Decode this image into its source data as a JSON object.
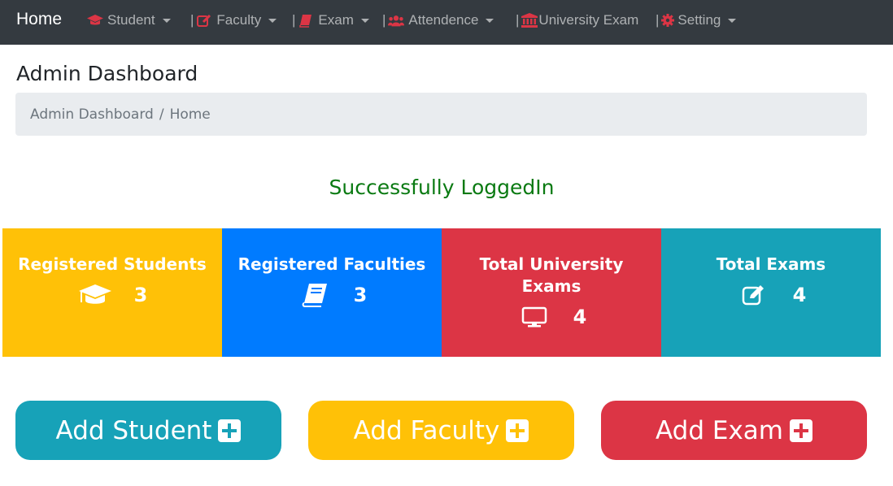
{
  "navbar": {
    "brand": "Home",
    "items": [
      {
        "label": "Student",
        "icon": "graduation-cap-icon",
        "separator": "",
        "dropdown": true
      },
      {
        "label": "Faculty",
        "icon": "edit-icon",
        "separator": "|",
        "dropdown": true
      },
      {
        "label": "Exam",
        "icon": "book-icon",
        "separator": "|",
        "dropdown": true
      },
      {
        "label": "Attendence",
        "icon": "users-icon",
        "separator": "|",
        "dropdown": true
      },
      {
        "label": "University Exam",
        "icon": "university-icon",
        "separator": "|",
        "dropdown": false
      },
      {
        "label": "Setting",
        "icon": "gear-icon",
        "separator": "|",
        "dropdown": true
      }
    ],
    "icon_color": "#dc3545"
  },
  "page": {
    "title": "Admin Dashboard",
    "breadcrumb": [
      "Admin Dashboard",
      "Home"
    ],
    "breadcrumb_separator": "/",
    "status_message": "Successfully LoggedIn"
  },
  "cards": [
    {
      "title": "Registered Students",
      "count": "3",
      "icon": "graduation-cap-icon",
      "color": "#ffc107"
    },
    {
      "title": "Registered Faculties",
      "count": "3",
      "icon": "book-icon",
      "color": "#007bff"
    },
    {
      "title": "Total University Exams",
      "count": "4",
      "icon": "desktop-icon",
      "color": "#dc3545"
    },
    {
      "title": "Total Exams",
      "count": "4",
      "icon": "edit-icon",
      "color": "#17a2b8"
    }
  ],
  "actions": [
    {
      "label": "Add Student",
      "icon": "plus-square-icon",
      "color": "#17a2b8"
    },
    {
      "label": "Add Faculty",
      "icon": "plus-square-icon",
      "color": "#ffc107"
    },
    {
      "label": "Add Exam",
      "icon": "plus-square-icon",
      "color": "#dc3545"
    }
  ]
}
